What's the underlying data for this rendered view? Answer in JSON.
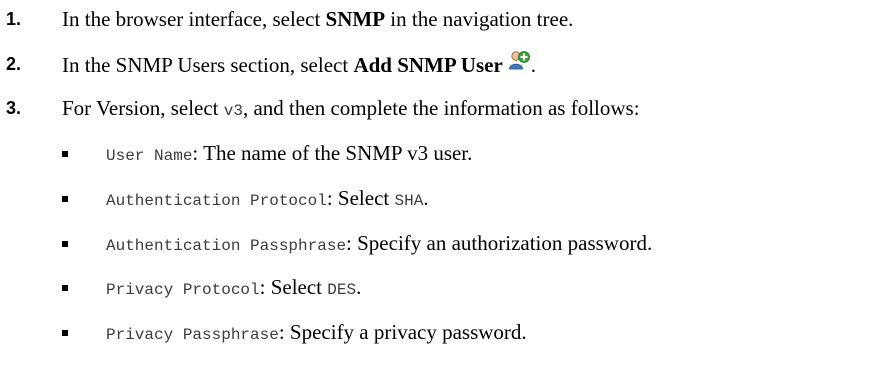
{
  "steps": [
    {
      "number": "1.",
      "pre": "In the browser interface, select ",
      "bold": "SNMP",
      "post": " in the navigation tree."
    },
    {
      "number": "2.",
      "pre": "In the SNMP Users section, select ",
      "bold": "Add SNMP User",
      "icon": "add-user-icon",
      "post": "."
    },
    {
      "number": "3.",
      "pre": "For Version, select ",
      "code": "v3",
      "post": ", and then complete the information as follows:"
    }
  ],
  "fields": [
    {
      "label": "User Name",
      "pre": ": The name of the SNMP v3 user.",
      "code": "",
      "post": ""
    },
    {
      "label": "Authentication Protocol",
      "pre": ": Select ",
      "code": "SHA",
      "post": "."
    },
    {
      "label": "Authentication Passphrase",
      "pre": ": Specify an authorization password.",
      "code": "",
      "post": ""
    },
    {
      "label": "Privacy Protocol",
      "pre": ": Select ",
      "code": "DES",
      "post": "."
    },
    {
      "label": "Privacy Passphrase",
      "pre": ": Specify a privacy password.",
      "code": "",
      "post": ""
    }
  ],
  "colors": {
    "text": "#000000",
    "code_text": "#3c3c3c",
    "icon_green": "#3aa63a",
    "icon_blue": "#3b78c8"
  }
}
